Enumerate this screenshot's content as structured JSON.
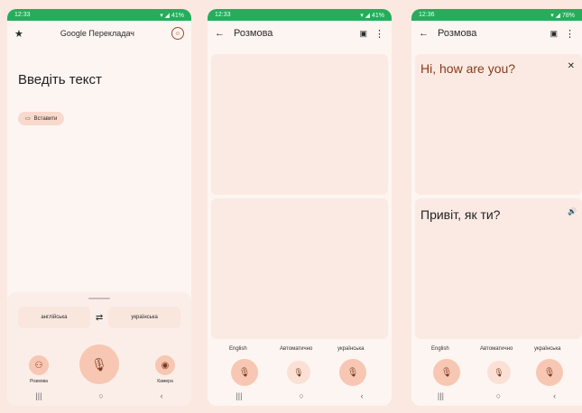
{
  "screen1": {
    "status_time": "12:33",
    "status_right": "▾ ◢ 41%",
    "app_title": "Google Перекладач",
    "input_placeholder": "Введіть текст",
    "paste_label": "Вставити",
    "source_lang": "англійська",
    "target_lang": "українська",
    "conversation_label": "Розмова",
    "camera_label": "Камера"
  },
  "screen2": {
    "status_time": "12:33",
    "status_right": "▾ ◢ 41%",
    "title": "Розмова",
    "lang_left": "English",
    "lang_middle": "Автоматично",
    "lang_right": "українська"
  },
  "screen3": {
    "status_time": "12:36",
    "status_right": "▾ ◢ 78%",
    "title": "Розмова",
    "source_text": "Hi, how are you?",
    "translated_text": "Привіт, як ти?",
    "lang_left": "English",
    "lang_middle": "Автоматично",
    "lang_right": "українська"
  },
  "colors": {
    "status_bar": "#25ad5c",
    "accent": "#f7c7b3",
    "background": "#fbe9e1",
    "source_text": "#8a3a1a"
  },
  "icons": [
    "star-icon",
    "account-icon",
    "back-arrow-icon",
    "layout-icon",
    "more-icon",
    "mic-icon",
    "swap-icon",
    "people-icon",
    "camera-icon",
    "close-icon",
    "speaker-icon",
    "clipboard-icon"
  ]
}
